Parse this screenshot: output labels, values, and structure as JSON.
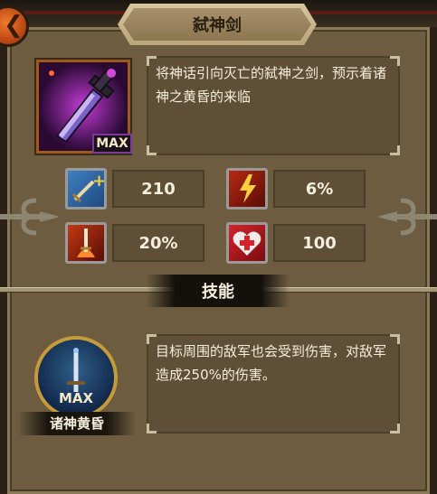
{
  "header": {
    "title": "弑神剑"
  },
  "weapon": {
    "level_badge": "MAX",
    "description": "将神话引向灭亡的弑神之剑，预示着诸神之黄昏的来临"
  },
  "stats": [
    {
      "icon": "sword-upgrade-icon",
      "value": "210"
    },
    {
      "icon": "lightning-fire-icon",
      "value": "6%"
    },
    {
      "icon": "flaming-sword-icon",
      "value": "20%"
    },
    {
      "icon": "health-heart-icon",
      "value": "100"
    }
  ],
  "skills": {
    "header": "技能",
    "skill": {
      "icon": "sword-medallion-icon",
      "level_badge": "MAX",
      "name": "诸神黄昏",
      "description": "目标周围的敌军也会受到伤害，对敌军造成250%的伤害。"
    }
  },
  "colors": {
    "panel": "#6d5c40",
    "text_box": "#5e4f36",
    "text": "#f4eedc",
    "close_button": "#e06a22",
    "banner": "#c9b58c"
  }
}
